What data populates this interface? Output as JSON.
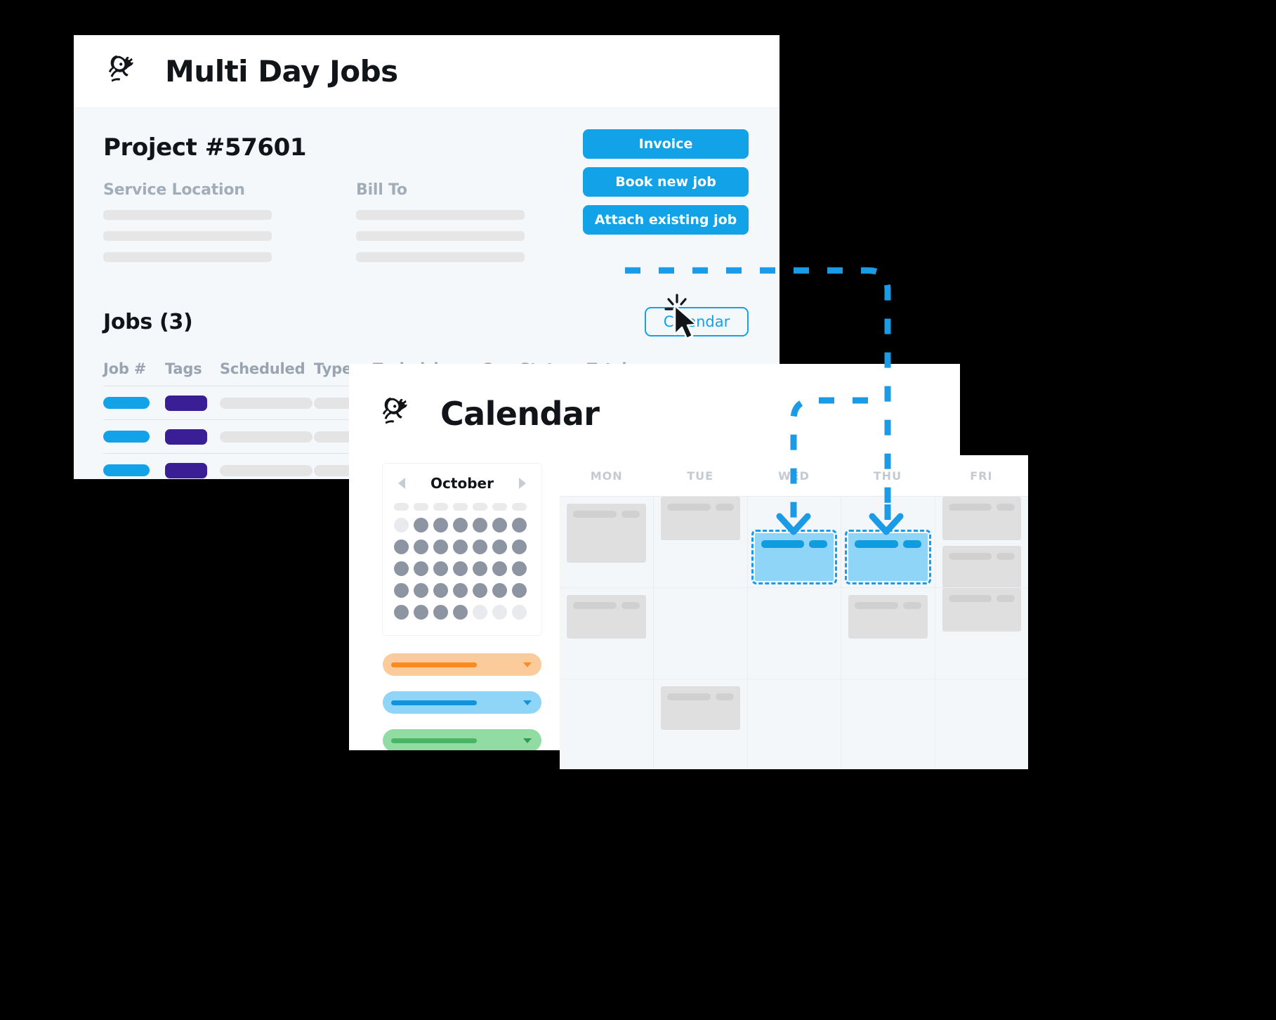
{
  "jobs_window": {
    "app_title": "Multi Day Jobs",
    "logo": "servicetitan-logo-icon",
    "project_title": "Project #57601",
    "info": [
      {
        "label": "Service Location",
        "lines": 3
      },
      {
        "label": "Bill To",
        "lines": 3
      }
    ],
    "actions": [
      {
        "label": "Invoice",
        "name": "invoice-button"
      },
      {
        "label": "Book new job",
        "name": "book-new-job-button"
      },
      {
        "label": "Attach existing job",
        "name": "attach-existing-job-button"
      }
    ],
    "jobs_heading": "Jobs (3)",
    "calendar_button": "Calendar",
    "table": {
      "columns": [
        "Job #",
        "Tags",
        "Scheduled",
        "Type",
        "Technicians",
        "On",
        "Status",
        "Total"
      ],
      "row_count": 3
    }
  },
  "cursor": {
    "name": "mouse-pointer-click-icon"
  },
  "calendar_window": {
    "title": "Calendar",
    "logo": "servicetitan-logo-icon",
    "mini_calendar": {
      "month": "October",
      "prev": "previous-month-arrow",
      "next": "next-month-arrow",
      "weekday_placeholders": 7,
      "weeks": [
        [
          "faded",
          "on",
          "on",
          "on",
          "on",
          "on",
          "on"
        ],
        [
          "on",
          "on",
          "on",
          "on",
          "on",
          "on",
          "on"
        ],
        [
          "on",
          "on",
          "on",
          "on",
          "on",
          "on",
          "on"
        ],
        [
          "on",
          "on",
          "on",
          "on",
          "on",
          "on",
          "on"
        ],
        [
          "on",
          "on",
          "on",
          "on",
          "faded",
          "faded",
          "faded"
        ]
      ]
    },
    "filters": [
      {
        "name": "filter-orange",
        "bg": "#fbcb9b",
        "bar": "#f98b20",
        "caret": "#f98b20"
      },
      {
        "name": "filter-blue",
        "bg": "#8ed5f8",
        "bar": "#1192dd",
        "caret": "#1192dd"
      },
      {
        "name": "filter-green",
        "bg": "#90dca2",
        "bar": "#48b464",
        "caret": "#2f9b4d"
      }
    ],
    "grid": {
      "day_headers": [
        "MON",
        "TUE",
        "WED",
        "THU",
        "FRI"
      ],
      "rows": [
        [
          {
            "type": "event",
            "size": "tall"
          },
          {
            "type": "event",
            "size": "mid",
            "offsetTop": true
          },
          {
            "type": "selected"
          },
          {
            "type": "selected"
          },
          {
            "type": "stack",
            "count": 2
          }
        ],
        [
          {
            "type": "event",
            "size": "mid"
          },
          {
            "type": "empty"
          },
          {
            "type": "empty"
          },
          {
            "type": "event",
            "size": "mid"
          },
          {
            "type": "event",
            "size": "mid",
            "offsetTop": true
          }
        ],
        [
          {
            "type": "empty"
          },
          {
            "type": "event",
            "size": "mid"
          },
          {
            "type": "empty"
          },
          {
            "type": "empty"
          },
          {
            "type": "empty"
          }
        ]
      ]
    }
  },
  "connector": {
    "name": "dashed-flow-connector",
    "color": "#1b9ae5",
    "arrow_targets": [
      "WED",
      "THU"
    ]
  },
  "colors": {
    "accent": "#11a2e8",
    "tag_purple": "#3a1e96",
    "page_bg": "#f4f8fb",
    "selected_event": "#8ed5f8"
  }
}
